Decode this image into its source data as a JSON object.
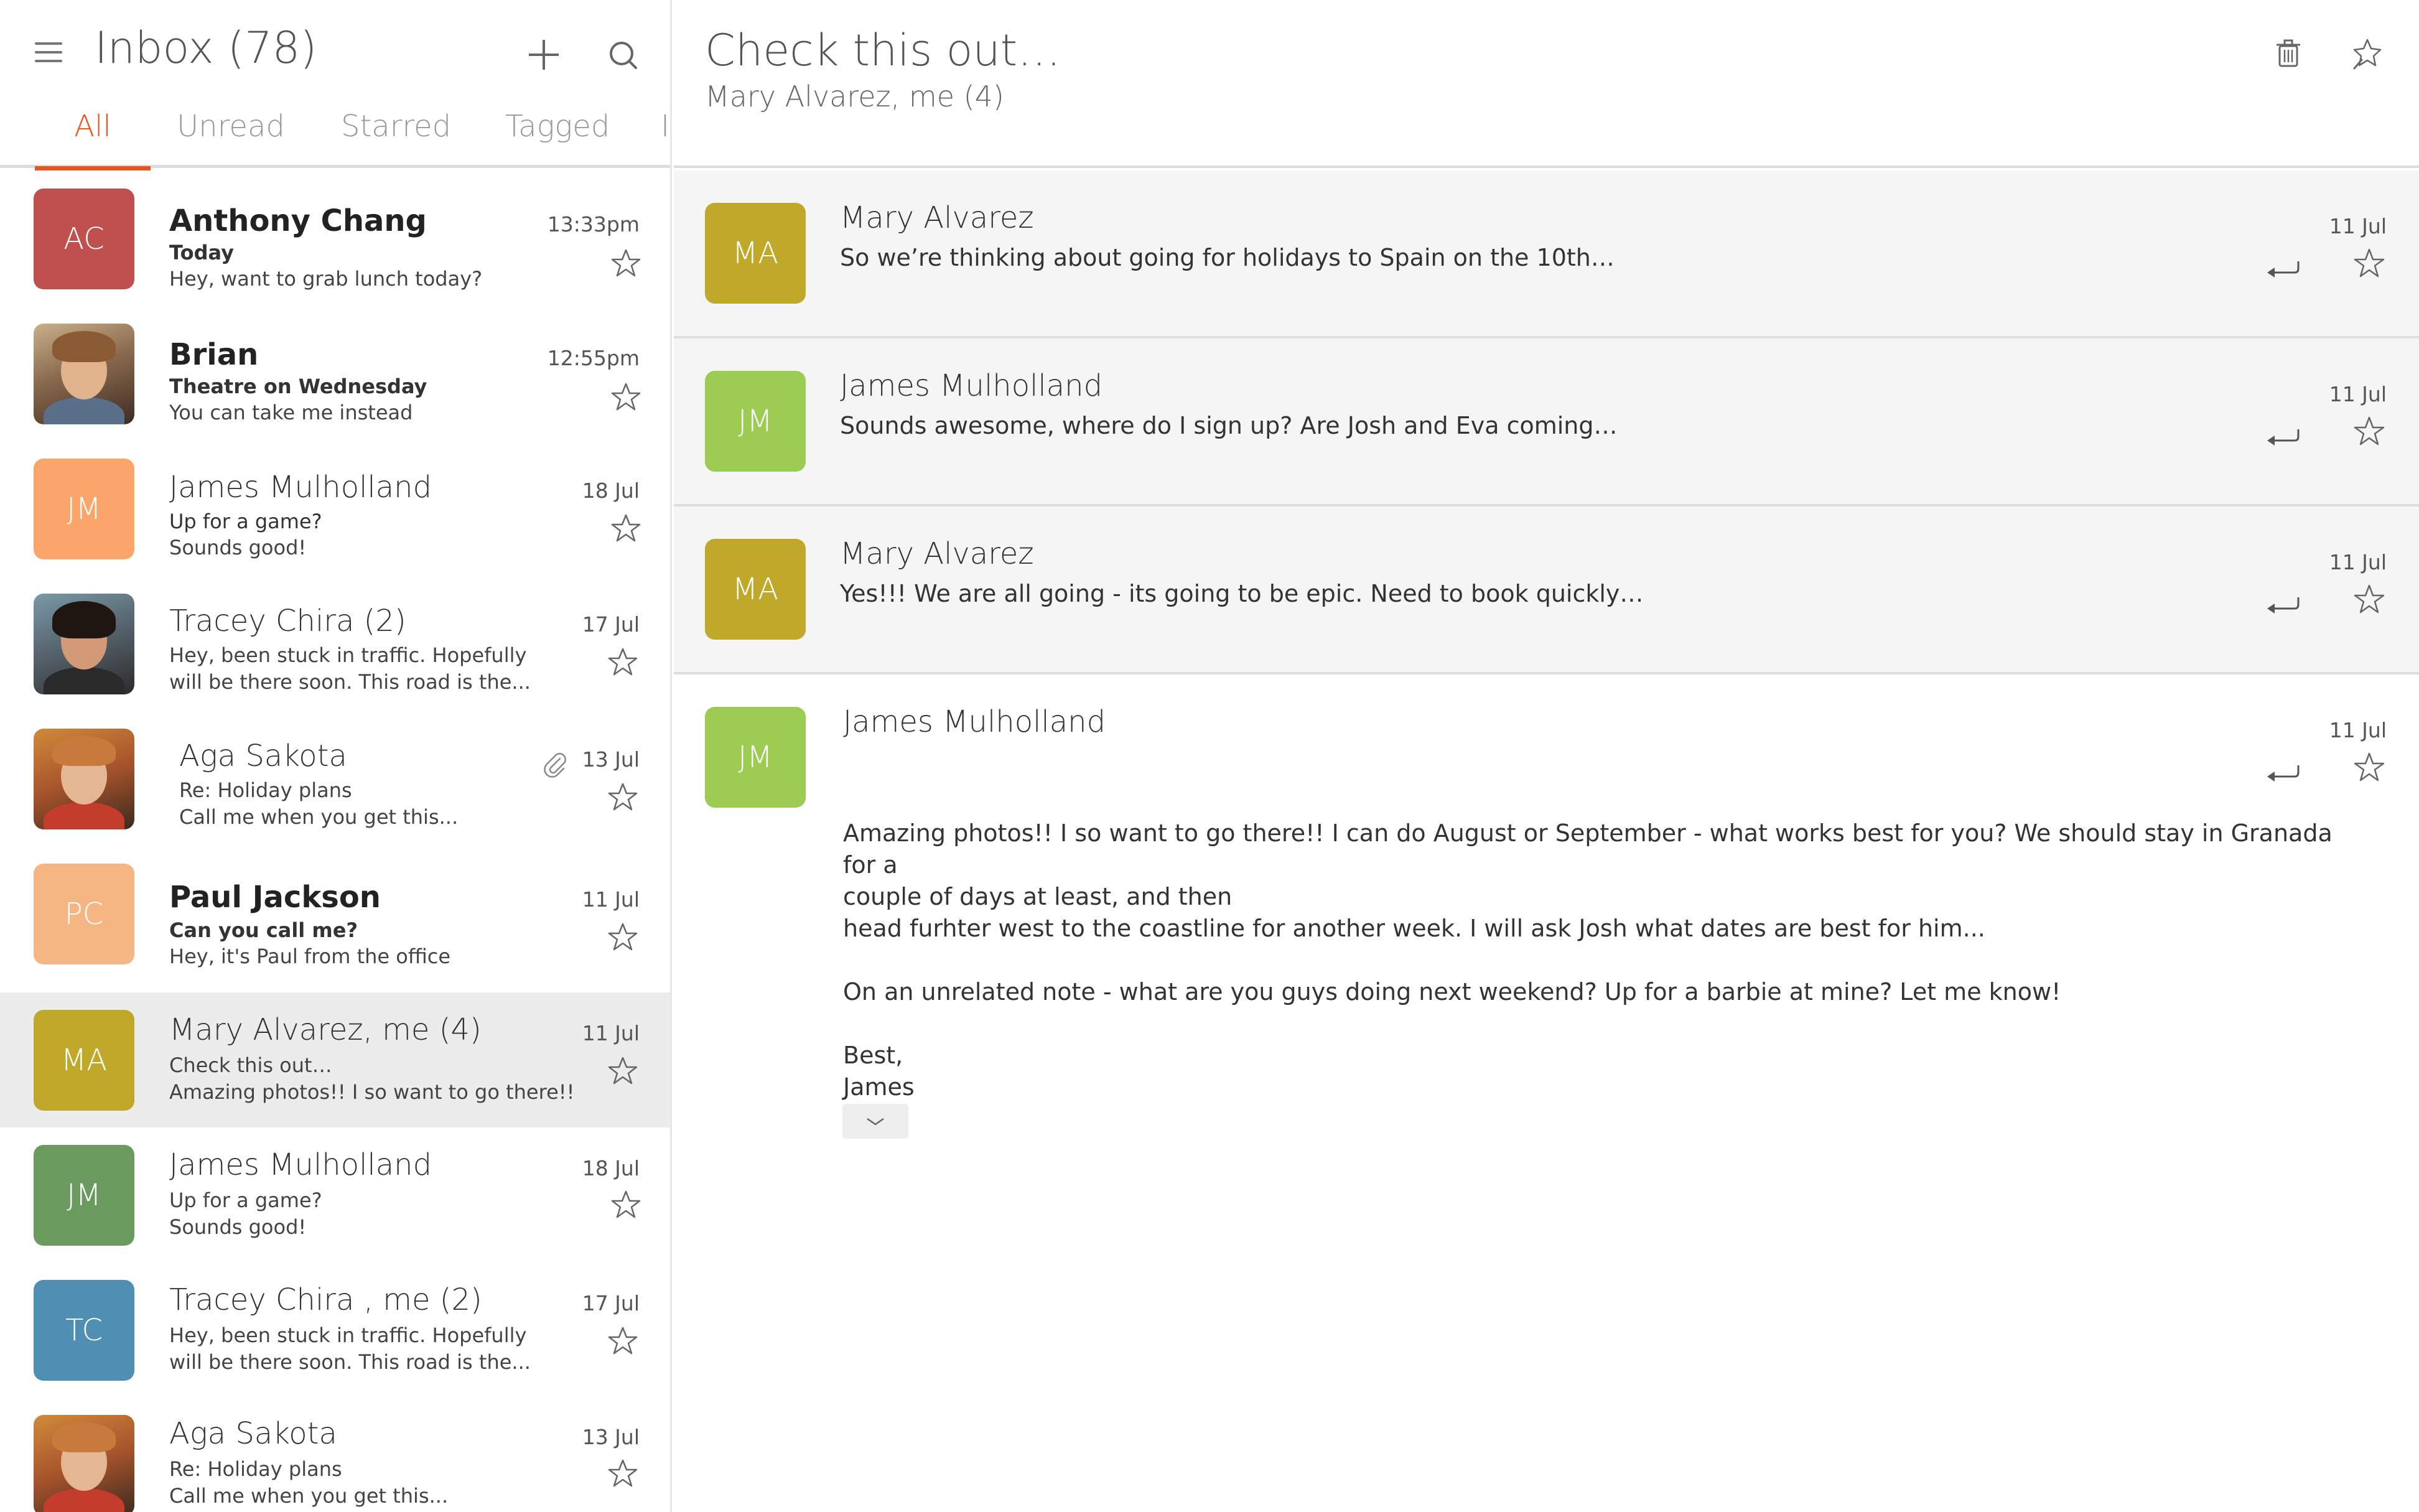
{
  "header": {
    "title": "Inbox (78)",
    "menu_icon": "hamburger-menu-icon",
    "compose_icon": "plus-icon",
    "search_icon": "search-icon"
  },
  "tabs": [
    {
      "label": "All",
      "active": true
    },
    {
      "label": "Unread",
      "active": false
    },
    {
      "label": "Starred",
      "active": false
    },
    {
      "label": "Tagged",
      "active": false
    },
    {
      "label": "I",
      "active": false
    }
  ],
  "colors": {
    "accent": "#e95420",
    "selected_row": "#ececec",
    "message_bg": "#f5f5f5"
  },
  "conversations": [
    {
      "initials": "AC",
      "avatar_color": "#c0504d",
      "name": "Anthony Chang",
      "subject": "Today",
      "preview": "Hey, want to grab lunch today?",
      "time": "13:33pm",
      "unread": true
    },
    {
      "initials": "",
      "avatar_color": "",
      "name": "Brian",
      "subject": "Theatre on Wednesday",
      "preview": "You can take me instead",
      "time": "12:55pm",
      "unread": true
    },
    {
      "initials": "JM",
      "avatar_color": "#fba56a",
      "name": "James Mulholland",
      "subject": "Up for a game?",
      "preview": "Sounds good!",
      "time": "18 Jul",
      "unread": false
    },
    {
      "initials": "",
      "avatar_color": "",
      "name": "Tracey Chira (2)",
      "subject": "Hey, been stuck in traffic. Hopefully",
      "preview": "will be there soon. This road is the...",
      "time": "17 Jul",
      "unread": false
    },
    {
      "initials": "",
      "avatar_color": "",
      "name": "Aga Sakota",
      "subject": "Re: Holiday plans",
      "preview": "Call me when you get this...",
      "time": "13 Jul",
      "unread": false,
      "attachment": true
    },
    {
      "initials": "PC",
      "avatar_color": "#f6b683",
      "name": "Paul Jackson",
      "subject": "Can you call me?",
      "preview": "Hey, it's Paul from the office",
      "time": "11 Jul",
      "unread": true
    },
    {
      "initials": "MA",
      "avatar_color": "#bfa82a",
      "name": "Mary Alvarez, me (4)",
      "subject": "Check this out…",
      "preview": "Amazing photos!! I so want to go there!!",
      "time": "11 Jul",
      "unread": false,
      "selected": true
    },
    {
      "initials": "JM",
      "avatar_color": "#6a9a5e",
      "name": "James Mulholland",
      "subject": "Up for a game?",
      "preview": "Sounds good!",
      "time": "18 Jul",
      "unread": false
    },
    {
      "initials": "TC",
      "avatar_color": "#4f8fb4",
      "name": "Tracey Chira , me (2)",
      "subject": "Hey, been stuck in traffic. Hopefully",
      "preview": "will be there soon. This road is the...",
      "time": "17 Jul",
      "unread": false
    },
    {
      "initials": "",
      "avatar_color": "",
      "name": "Aga Sakota",
      "subject": "Re: Holiday plans",
      "preview": "Call me when you get this...",
      "time": "13 Jul",
      "unread": false
    }
  ],
  "thread": {
    "subject": "Check this out…",
    "participants": "Mary Alvarez, me (4)",
    "delete_icon": "trash-icon",
    "pin_icon": "pin-icon",
    "messages": [
      {
        "initials": "MA",
        "avatar_color": "#bfa82a",
        "sender": "Mary Alvarez",
        "snippet": "So we’re thinking about going for holidays to Spain on the 10th…",
        "date": "11 Jul"
      },
      {
        "initials": "JM",
        "avatar_color": "#9ccc52",
        "sender": "James Mulholland",
        "snippet": "Sounds awesome, where do I sign up? Are Josh and Eva coming…",
        "date": "11 Jul"
      },
      {
        "initials": "MA",
        "avatar_color": "#bfa82a",
        "sender": "Mary Alvarez",
        "snippet": "Yes!!! We are all going - its going to be epic. Need to book quickly…",
        "date": "11 Jul"
      }
    ],
    "open_message": {
      "initials": "JM",
      "avatar_color": "#9ccc52",
      "sender": "James Mulholland",
      "date": "11 Jul",
      "paragraph1": "Amazing photos!! I so want to go there!! I can do  August or September - what works best for you? We should stay in Granada for a\ncouple of days at least, and then\nhead   furhter west to the coastline for another week. I will ask Josh what dates are best for him...",
      "paragraph2": "On an unrelated note - what are you guys doing next weekend? Up for a barbie at mine? Let me know!",
      "signoff": "Best,\nJames",
      "expand_icon": "chevron-down-icon"
    }
  }
}
